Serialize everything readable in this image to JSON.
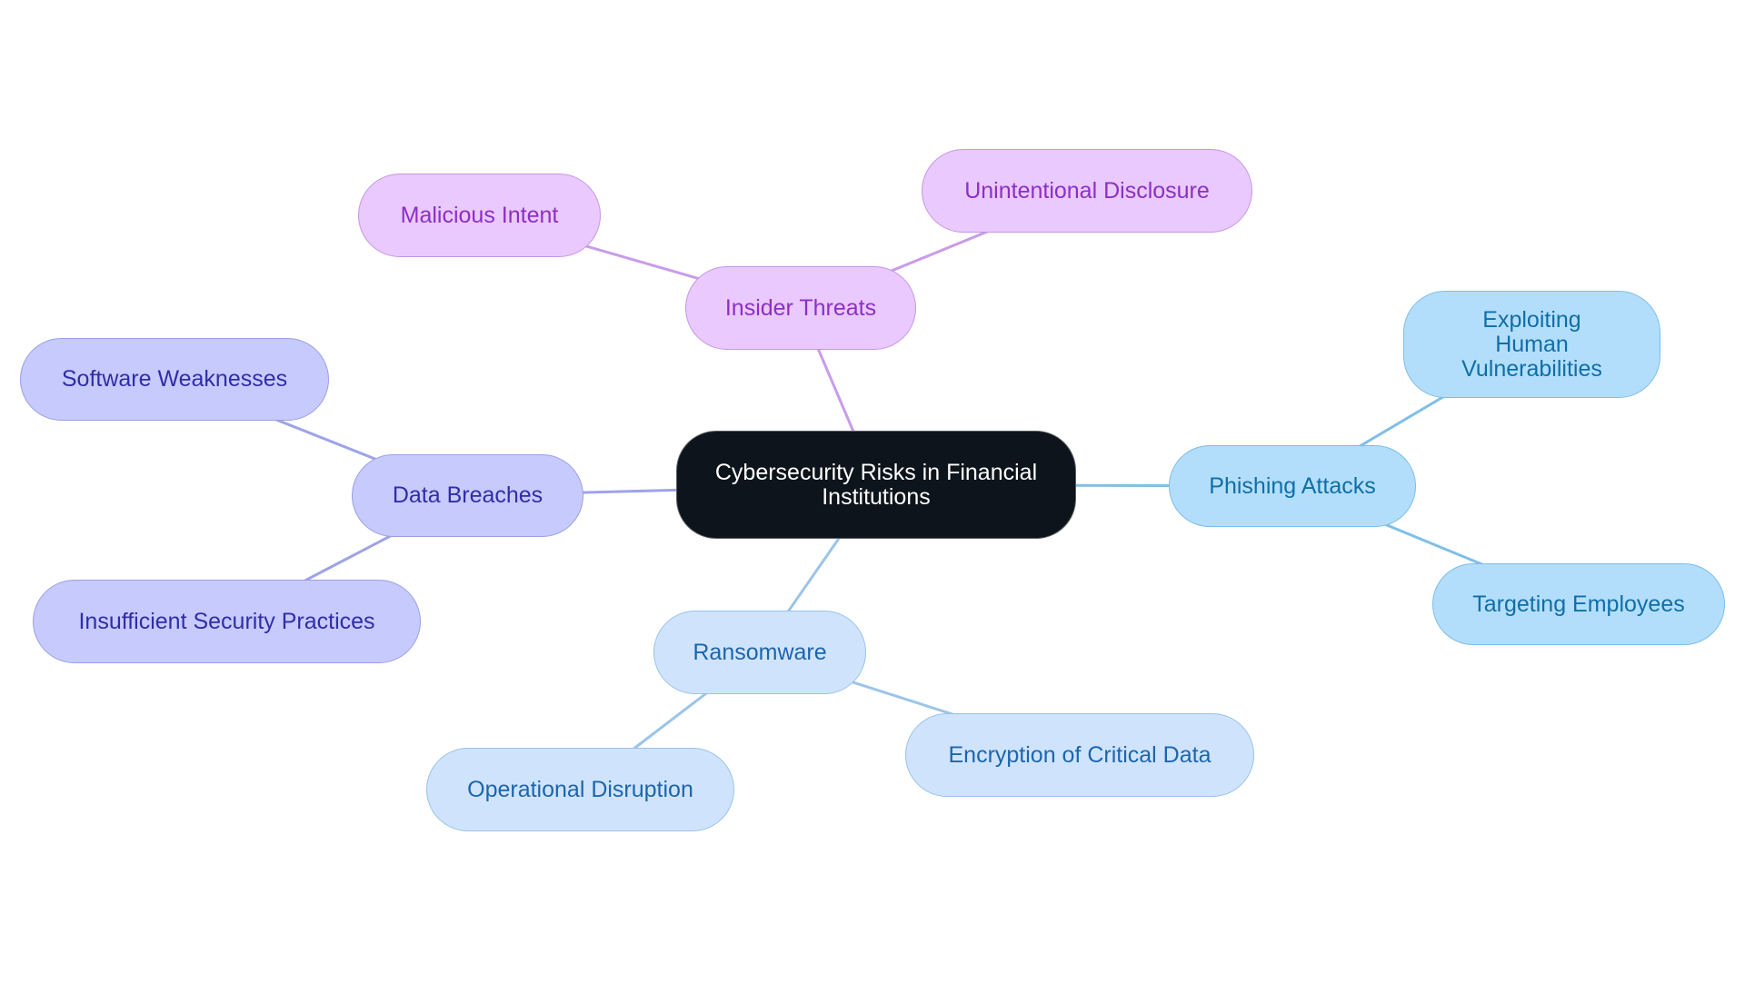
{
  "diagram": {
    "type": "mindmap",
    "root": {
      "id": "root",
      "label": "Cybersecurity Risks in Financial Institutions"
    },
    "branches": [
      {
        "id": "insider",
        "label": "Insider Threats",
        "theme": "purple",
        "edge_color": "#c89cea",
        "children": [
          {
            "id": "malicious",
            "label": "Malicious Intent"
          },
          {
            "id": "unintentional",
            "label": "Unintentional Disclosure"
          }
        ]
      },
      {
        "id": "phishing",
        "label": "Phishing Attacks",
        "theme": "sky",
        "edge_color": "#80bfe8",
        "children": [
          {
            "id": "exploiting",
            "label": "Exploiting Human Vulnerabilities"
          },
          {
            "id": "targeting",
            "label": "Targeting Employees"
          }
        ]
      },
      {
        "id": "breaches",
        "label": "Data Breaches",
        "theme": "indigo",
        "edge_color": "#9ea3e8",
        "children": [
          {
            "id": "software",
            "label": "Software Weaknesses"
          },
          {
            "id": "insufficient",
            "label": "Insufficient Security Practices"
          }
        ]
      },
      {
        "id": "ransomware",
        "label": "Ransomware",
        "theme": "lblue",
        "edge_color": "#9cc4ea",
        "children": [
          {
            "id": "operational",
            "label": "Operational Disruption"
          },
          {
            "id": "encryption",
            "label": "Encryption of Critical Data"
          }
        ]
      }
    ],
    "colors": {
      "root_fill": "#0d141b",
      "root_text": "#ffffff",
      "purple_fill": "#e9c9fe",
      "purple_text": "#8d2fc6",
      "indigo_fill": "#c7cafd",
      "indigo_text": "#2f2ea8",
      "sky_fill": "#b3defb",
      "sky_text": "#0f6fa8",
      "lblue_fill": "#cfe4fc",
      "lblue_text": "#1d65ad"
    }
  }
}
